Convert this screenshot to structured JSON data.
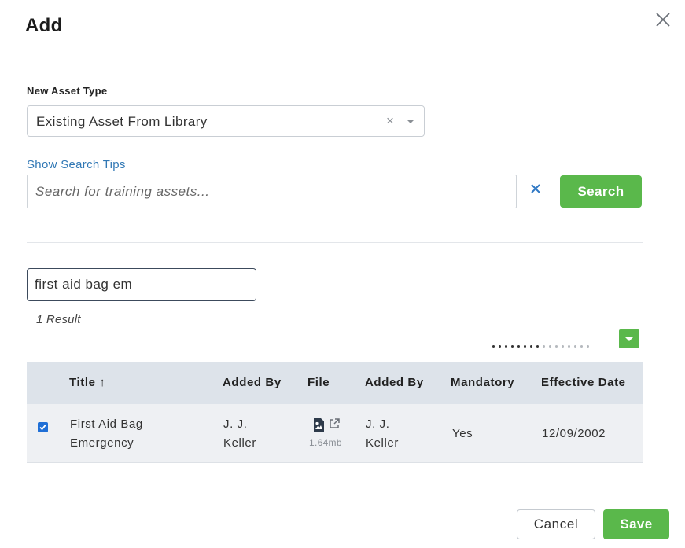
{
  "dialog": {
    "title": "Add",
    "close_icon": "close-icon"
  },
  "asset_type": {
    "label": "New Asset Type",
    "selected": "Existing Asset From Library",
    "clear_glyph": "×"
  },
  "search": {
    "tips_link": "Show Search Tips",
    "placeholder": "Search for training assets...",
    "value": "",
    "button_label": "Search"
  },
  "filter": {
    "value": "first aid bag em"
  },
  "results": {
    "count_text": "1 Result"
  },
  "table": {
    "columns": [
      "Title ↑",
      "Added By",
      "File",
      "Added By",
      "Mandatory",
      "Effective Date"
    ],
    "rows": [
      {
        "checked": true,
        "title_line1": "First Aid Bag",
        "title_line2": "Emergency",
        "added_by_line1": "J. J.",
        "added_by_line2": "Keller",
        "file_size": "1.64mb",
        "added_by2_line1": "J. J.",
        "added_by2_line2": "Keller",
        "mandatory": "Yes",
        "effective_date": "12/09/2002"
      }
    ]
  },
  "footer": {
    "cancel_label": "Cancel",
    "save_label": "Save"
  },
  "colors": {
    "accent_green": "#5ab84b",
    "link_blue": "#3178b5",
    "header_row": "#dde3ea"
  }
}
